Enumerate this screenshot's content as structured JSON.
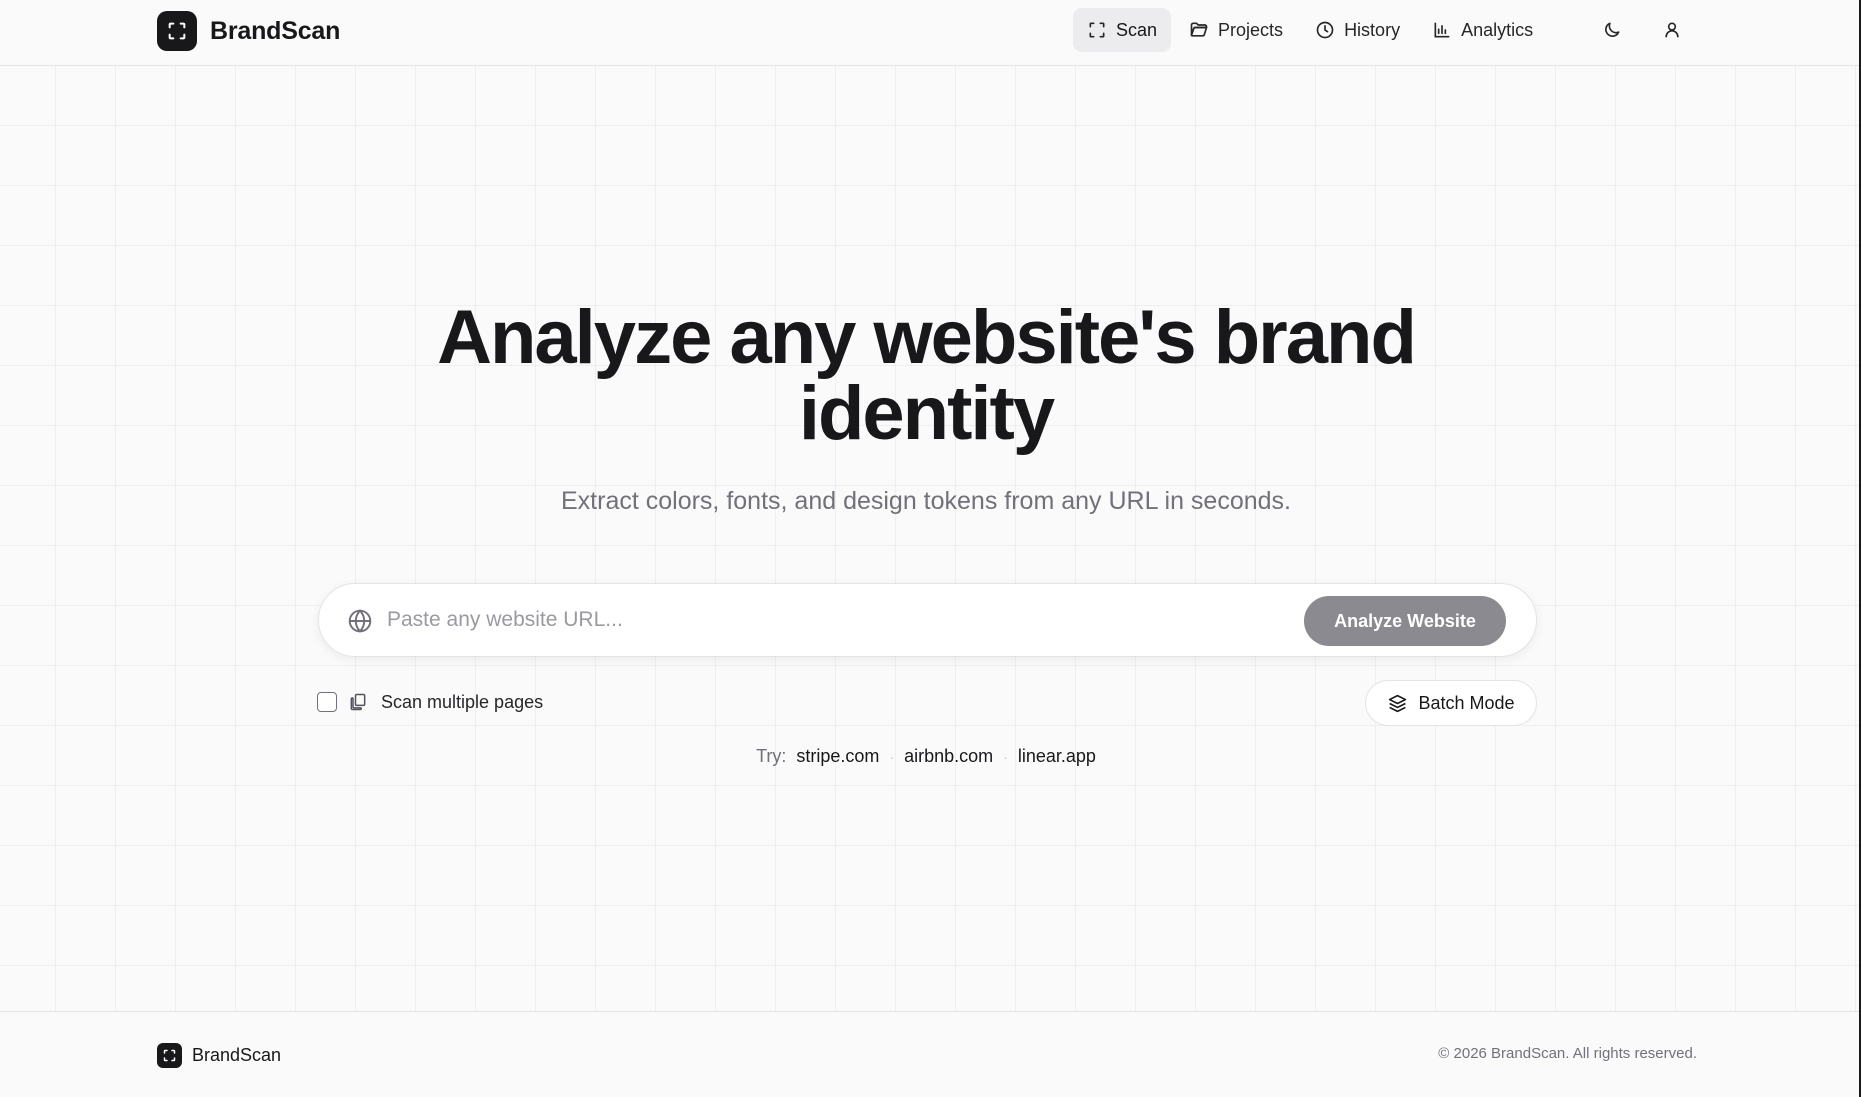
{
  "header": {
    "brand": "BrandScan",
    "nav": [
      {
        "label": "Scan",
        "icon": "scan-icon",
        "active": true
      },
      {
        "label": "Projects",
        "icon": "folder-icon",
        "active": false
      },
      {
        "label": "History",
        "icon": "clock-icon",
        "active": false
      },
      {
        "label": "Analytics",
        "icon": "bar-chart-icon",
        "active": false
      }
    ],
    "theme_toggle_icon": "moon-icon",
    "account_icon": "user-icon"
  },
  "hero": {
    "title_line1": "Analyze any website's brand",
    "title_line2": "identity",
    "subtitle": "Extract colors, fonts, and design tokens from any URL in seconds."
  },
  "search": {
    "value": "",
    "placeholder": "Paste any website URL...",
    "button_label": "Analyze Website",
    "icon": "globe-icon"
  },
  "options": {
    "multi_pages_label": "Scan multiple pages",
    "multi_pages_checked": false,
    "batch_label": "Batch Mode"
  },
  "try": {
    "label": "Try:",
    "separator": "·",
    "examples": [
      "stripe.com",
      "airbnb.com",
      "linear.app"
    ]
  },
  "footer": {
    "brand": "BrandScan",
    "copyright": "© 2026 BrandScan. All rights reserved."
  },
  "colors": {
    "primary": "#18181b",
    "muted_text": "#71717a",
    "button_disabled": "#8a8a90",
    "background": "#fafafa",
    "border": "#e4e4e7"
  }
}
